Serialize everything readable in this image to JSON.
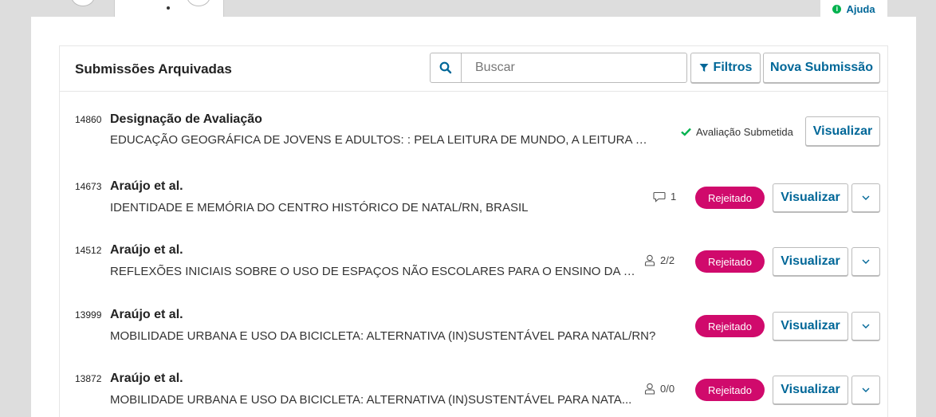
{
  "help": {
    "label": "Ajuda"
  },
  "panel": {
    "title": "Submissões Arquivadas",
    "search_placeholder": "Buscar",
    "filters_label": "Filtros",
    "new_submission_label": "Nova Submissão"
  },
  "rows": [
    {
      "id": "14860",
      "author": "Designação de Avaliação",
      "title": "EDUCAÇÃO GEOGRÁFICA DE JOVENS E ADULTOS: : PELA LEITURA DE MUNDO, A LEITURA DA “...",
      "status": "Avaliação Submetida",
      "view_label": "Visualizar"
    },
    {
      "id": "14673",
      "author": "Araújo et al.",
      "title": "IDENTIDADE E MEMÓRIA DO CENTRO HISTÓRICO DE NATAL/RN, BRASIL",
      "meta_value": "1",
      "badge": "Rejeitado",
      "view_label": "Visualizar"
    },
    {
      "id": "14512",
      "author": "Araújo et al.",
      "title": "REFLEXÕES INICIAIS SOBRE O USO DE ESPAÇOS NÃO ESCOLARES PARA O ENSINO DA GE...",
      "meta_value": "2/2",
      "badge": "Rejeitado",
      "view_label": "Visualizar"
    },
    {
      "id": "13999",
      "author": "Araújo et al.",
      "title": "MOBILIDADE URBANA E USO DA BICICLETA: ALTERNATIVA (IN)SUSTENTÁVEL PARA NATAL/RN?",
      "badge": "Rejeitado",
      "view_label": "Visualizar"
    },
    {
      "id": "13872",
      "author": "Araújo et al.",
      "title": "MOBILIDADE URBANA E USO DA BICICLETA: ALTERNATIVA (IN)SUSTENTÁVEL PARA NATA...",
      "meta_value": "0/0",
      "badge": "Rejeitado",
      "view_label": "Visualizar"
    }
  ],
  "colors": {
    "accent": "#006798",
    "rejected": "#d00a6c",
    "success": "#00b24e"
  }
}
